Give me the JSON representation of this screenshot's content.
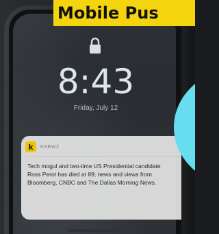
{
  "banner": {
    "title": "Mobile Pus"
  },
  "lockscreen": {
    "time": "8:43",
    "date": "Friday, July 12"
  },
  "notification": {
    "app_icon_letter": "k",
    "app_name": "KNEWZ",
    "body": "Tech mogul and two-time US Presidential candidate Ross Perot has died at 89; news and views from Bloomberg, CNBC and The Dallas Morning News."
  },
  "colors": {
    "banner_bg": "#f4d40d",
    "accent_circle": "#66def0",
    "app_icon_bg": "#f2c400"
  },
  "icons": {
    "lock": "lock-icon"
  }
}
